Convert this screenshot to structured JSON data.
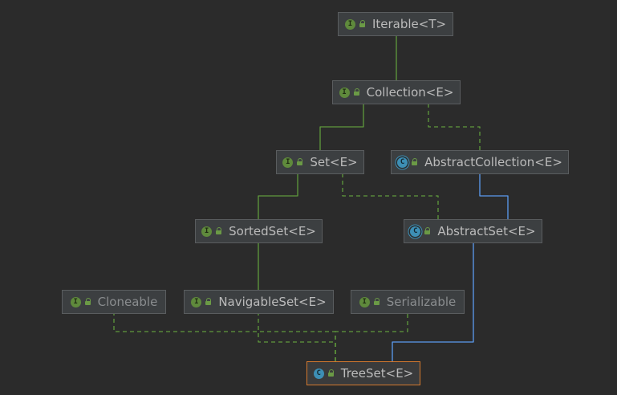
{
  "colors": {
    "background": "#2b2b2b",
    "node_fill": "#3c3f41",
    "node_border": "#5a5d5f",
    "selected_border": "#d2782e",
    "implements_edge": "#5f9a3c",
    "extends_edge": "#5b9bf0"
  },
  "nodes": [
    {
      "id": "iterable",
      "label": "Iterable<T>",
      "kind": "interface",
      "icon": "interface-icon",
      "faded": true
    },
    {
      "id": "collection",
      "label": "Collection<E>",
      "kind": "interface",
      "icon": "interface-icon"
    },
    {
      "id": "set",
      "label": "Set<E>",
      "kind": "interface",
      "icon": "interface-icon"
    },
    {
      "id": "abstractcollection",
      "label": "AbstractCollection<E>",
      "kind": "abstract-class",
      "icon": "abstract-class-icon"
    },
    {
      "id": "sortedset",
      "label": "SortedSet<E>",
      "kind": "interface",
      "icon": "interface-icon"
    },
    {
      "id": "abstractset",
      "label": "AbstractSet<E>",
      "kind": "abstract-class",
      "icon": "abstract-class-icon"
    },
    {
      "id": "cloneable",
      "label": "Cloneable",
      "kind": "interface",
      "icon": "interface-icon",
      "faded": true
    },
    {
      "id": "navigableset",
      "label": "NavigableSet<E>",
      "kind": "interface",
      "icon": "interface-icon"
    },
    {
      "id": "serializable",
      "label": "Serializable",
      "kind": "interface",
      "icon": "interface-icon",
      "faded": true
    },
    {
      "id": "treeset",
      "label": "TreeSet<E>",
      "kind": "class",
      "icon": "class-icon",
      "selected": true
    }
  ],
  "edges": [
    {
      "from": "collection",
      "to": "iterable",
      "type": "interface-extends"
    },
    {
      "from": "set",
      "to": "collection",
      "type": "interface-extends"
    },
    {
      "from": "abstractcollection",
      "to": "collection",
      "type": "implements"
    },
    {
      "from": "sortedset",
      "to": "set",
      "type": "interface-extends"
    },
    {
      "from": "abstractset",
      "to": "set",
      "type": "implements"
    },
    {
      "from": "abstractset",
      "to": "abstractcollection",
      "type": "extends"
    },
    {
      "from": "navigableset",
      "to": "sortedset",
      "type": "interface-extends"
    },
    {
      "from": "treeset",
      "to": "cloneable",
      "type": "implements"
    },
    {
      "from": "treeset",
      "to": "navigableset",
      "type": "implements"
    },
    {
      "from": "treeset",
      "to": "serializable",
      "type": "implements"
    },
    {
      "from": "treeset",
      "to": "abstractset",
      "type": "extends"
    }
  ]
}
